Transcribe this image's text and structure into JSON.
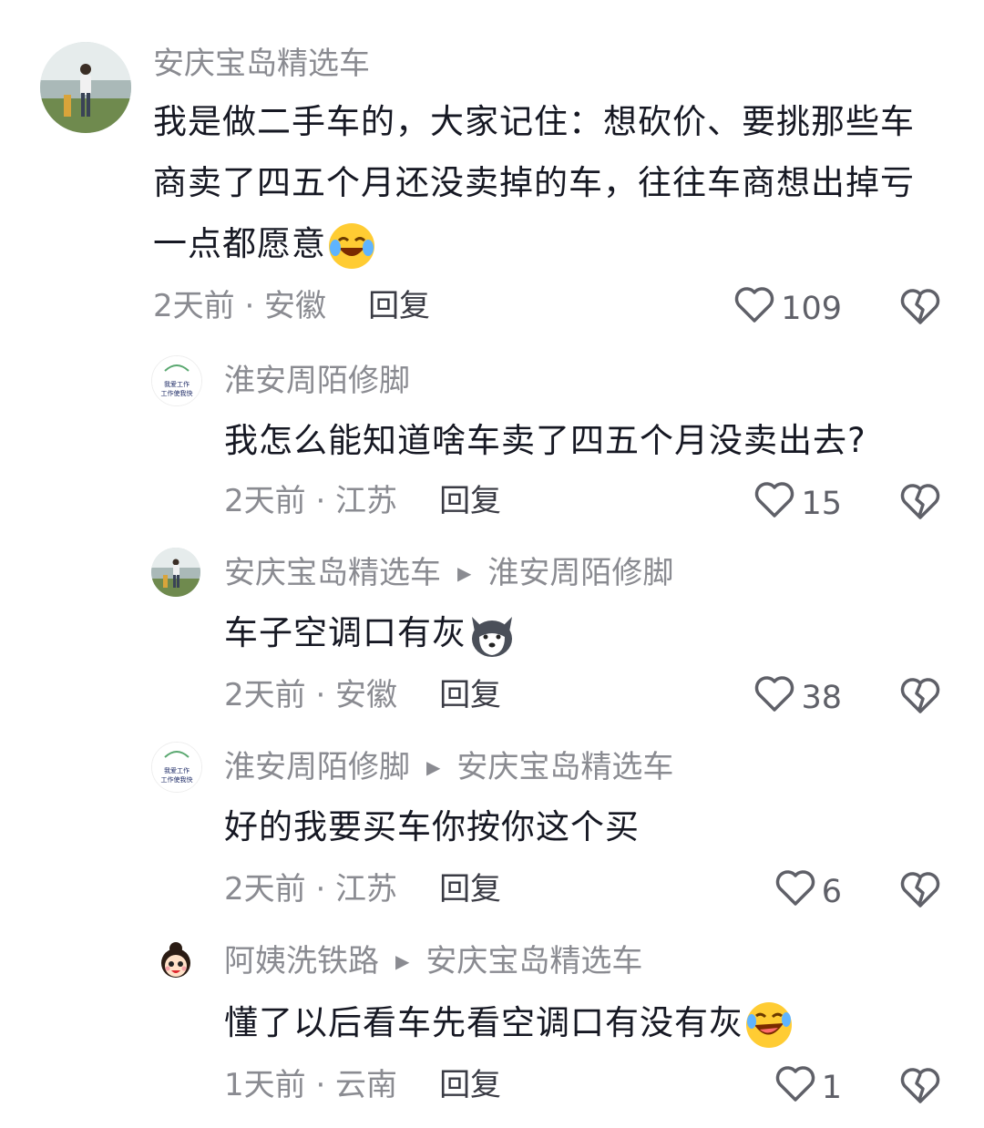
{
  "comments": [
    {
      "author": "安庆宝岛精选车",
      "reply_to": "",
      "text": "我是做二手车的，大家记住：想砍价、要挑那些车商卖了四五个月还没卖掉的车，往往车商想出掉亏一点都愿意",
      "emoji": "crying-laughing-emoji",
      "time_location": "2天前 · 安徽",
      "reply_label": "回复",
      "likes": "109"
    },
    {
      "author": "淮安周陌修脚",
      "reply_to": "",
      "text": "我怎么能知道啥车卖了四五个月没卖出去?",
      "emoji": "",
      "time_location": "2天前 · 江苏",
      "reply_label": "回复",
      "likes": "15"
    },
    {
      "author": "安庆宝岛精选车",
      "reply_to": "淮安周陌修脚",
      "text": "车子空调口有灰",
      "emoji": "husky-dog-emoji",
      "time_location": "2天前 · 安徽",
      "reply_label": "回复",
      "likes": "38"
    },
    {
      "author": "淮安周陌修脚",
      "reply_to": "安庆宝岛精选车",
      "text": "好的我要买车你按你这个买",
      "emoji": "",
      "time_location": "2天前 · 江苏",
      "reply_label": "回复",
      "likes": "6"
    },
    {
      "author": "阿姨洗铁路",
      "reply_to": "安庆宝岛精选车",
      "text": "懂了以后看车先看空调口有没有灰",
      "emoji": "rolling-laughing-emoji",
      "time_location": "1天前 · 云南",
      "reply_label": "回复",
      "likes": "1"
    }
  ],
  "avatar_logo_text": "我爱工作 工作使我快乐",
  "icons": {
    "like": "heart-outline-icon",
    "dislike": "broken-heart-icon",
    "reply_arrow": "triangle-right-icon"
  },
  "colors": {
    "primary_text": "#161823",
    "secondary_text": "#8a8b91",
    "reply_text": "#3a3b44",
    "background": "#ffffff"
  }
}
